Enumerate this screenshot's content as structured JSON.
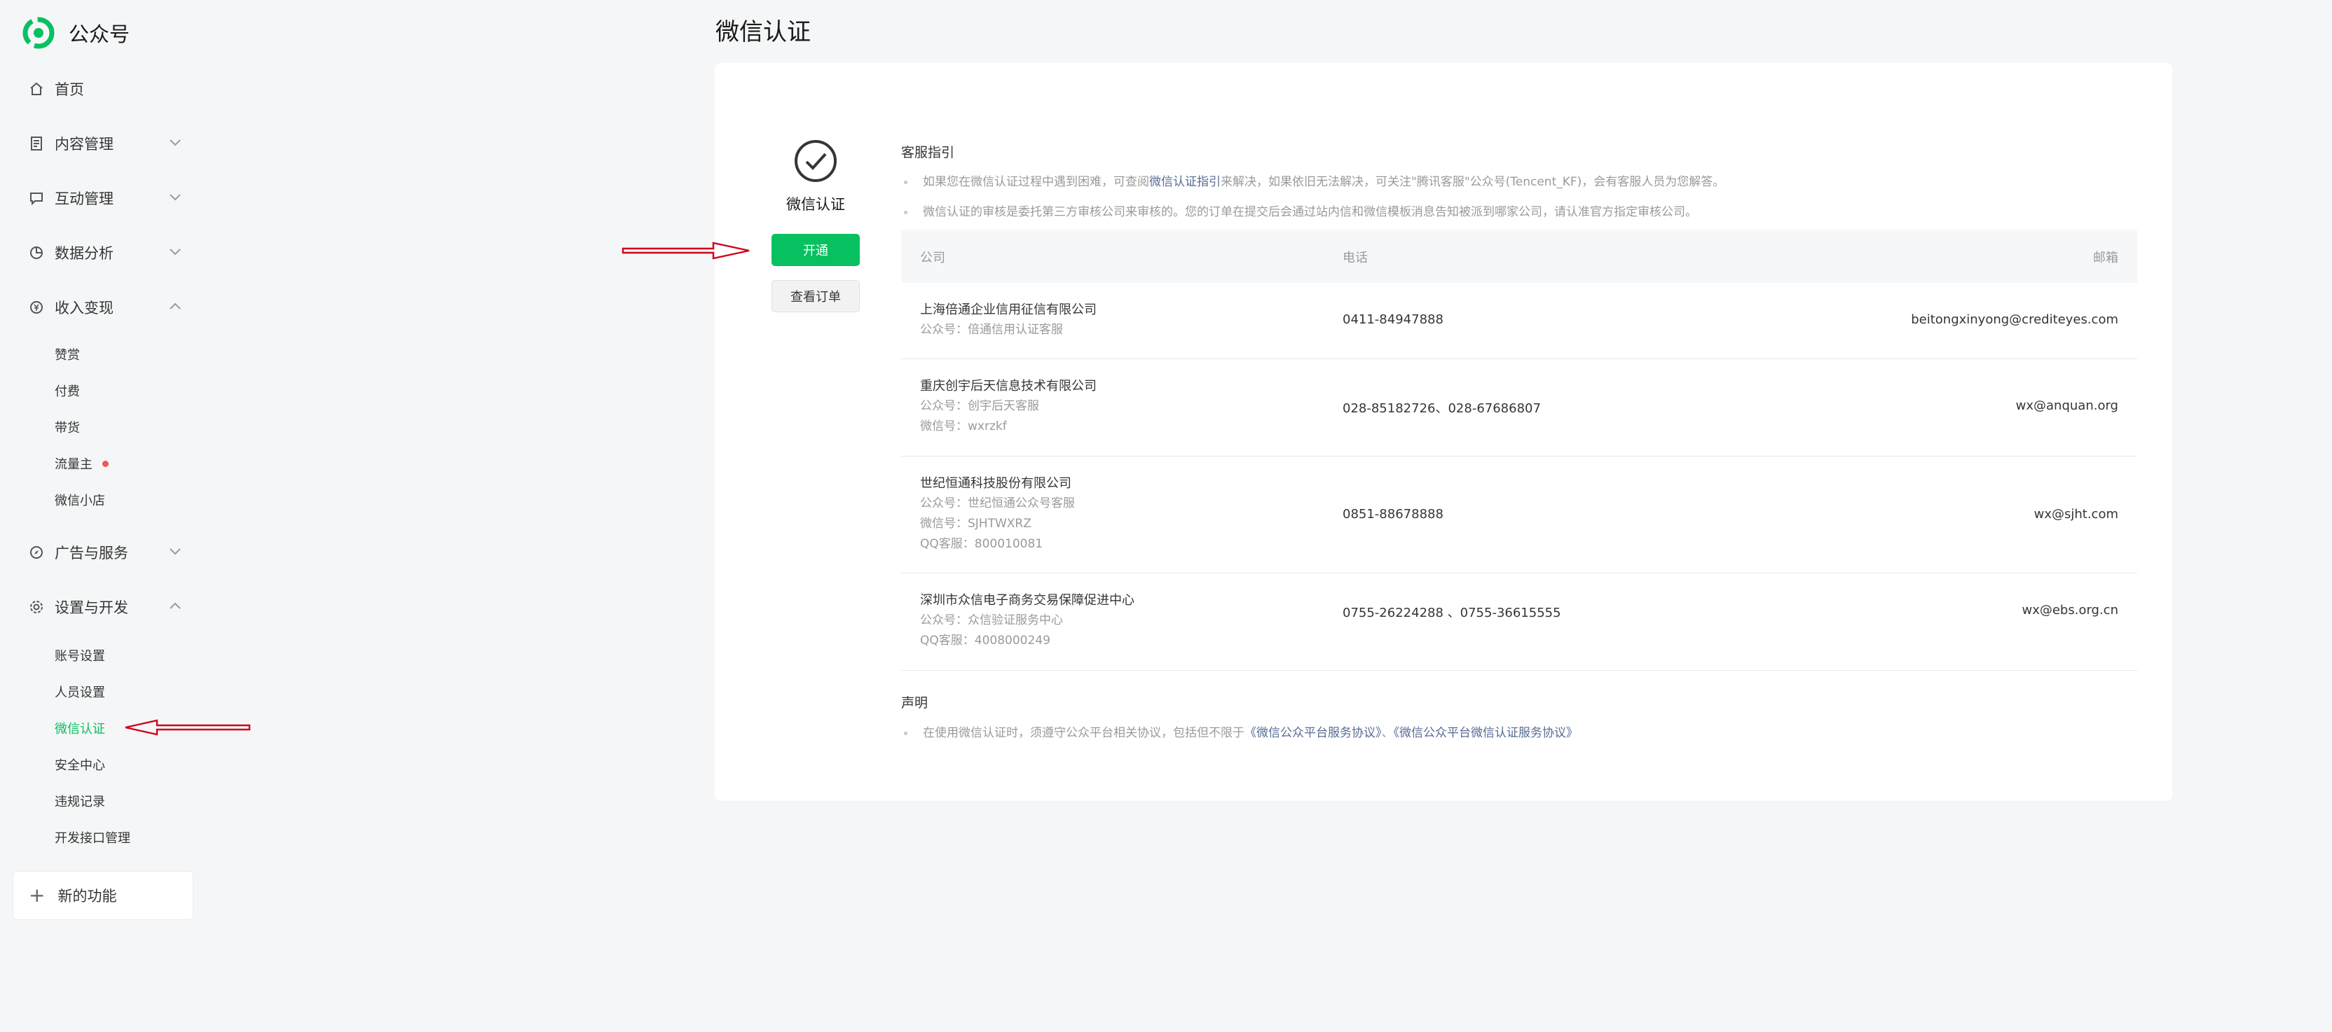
{
  "brand": {
    "name": "公众号",
    "logo_icon": "wechat-official-account-logo",
    "logo_color": "#07c160"
  },
  "sidebar": {
    "items": [
      {
        "label": "首页",
        "icon": "home-icon"
      },
      {
        "label": "内容管理",
        "icon": "document-icon",
        "expanded": false
      },
      {
        "label": "互动管理",
        "icon": "chat-icon",
        "expanded": false
      },
      {
        "label": "数据分析",
        "icon": "pie-chart-icon",
        "expanded": false
      },
      {
        "label": "收入变现",
        "icon": "yen-icon",
        "expanded": true,
        "children": [
          "赞赏",
          "付费",
          "带货",
          "流量主",
          "微信小店"
        ]
      },
      {
        "label": "广告与服务",
        "icon": "compass-icon",
        "expanded": false
      },
      {
        "label": "设置与开发",
        "icon": "gear-icon",
        "expanded": true,
        "children": [
          "账号设置",
          "人员设置",
          "微信认证",
          "安全中心",
          "违规记录",
          "开发接口管理"
        ],
        "active_child": "微信认证"
      }
    ],
    "new_features": "新的功能"
  },
  "page": {
    "title": "微信认证",
    "badge_label": "微信认证",
    "activate_button": "开通",
    "view_orders_button": "查看订单"
  },
  "service_guide": {
    "title": "客服指引",
    "line1_before": "如果您在微信认证过程中遇到困难，可查阅",
    "line1_link": "微信认证指引",
    "line1_after": "来解决，如果依旧无法解决，可关注\"腾讯客服\"公众号(Tencent_KF)，会有客服人员为您解答。",
    "line2": "微信认证的审核是委托第三方审核公司来审核的。您的订单在提交后会通过站内信和微信模板消息告知被派到哪家公司，请认准官方指定审核公司。"
  },
  "table": {
    "headers": {
      "company": "公司",
      "phone": "电话",
      "email": "邮箱"
    },
    "rows": [
      {
        "company": "上海倍通企业信用征信有限公司",
        "details": [
          "公众号：倍通信用认证客服"
        ],
        "phone": "0411-84947888",
        "email": "beitongxinyong@crediteyes.com"
      },
      {
        "company": "重庆创宇后天信息技术有限公司",
        "details": [
          "公众号：创宇后天客服",
          "微信号：wxrzkf"
        ],
        "phone": "028-85182726、028-67686807",
        "email": "wx@anquan.org"
      },
      {
        "company": "世纪恒通科技股份有限公司",
        "details": [
          "公众号：世纪恒通公众号客服",
          "微信号：SJHTWXRZ",
          "QQ客服：800010081"
        ],
        "phone": "0851-88678888",
        "email": "wx@sjht.com"
      },
      {
        "company": "深圳市众信电子商务交易保障促进中心",
        "details": [
          "公众号：众信验证服务中心",
          "QQ客服：4008000249"
        ],
        "phone": "0755-26224288 、0755-36615555",
        "email": "wx@ebs.org.cn"
      }
    ]
  },
  "declaration": {
    "title": "声明",
    "text_before": "在使用微信认证时，须遵守公众平台相关协议，包括但不限于",
    "link1": "《微信公众平台服务协议》",
    "sep": "、",
    "link2": "《微信公众平台微信认证服务协议》"
  },
  "colors": {
    "accent": "#07c160",
    "link": "#576b95",
    "arrow": "#d0021b",
    "alert_dot": "#fa5151"
  }
}
